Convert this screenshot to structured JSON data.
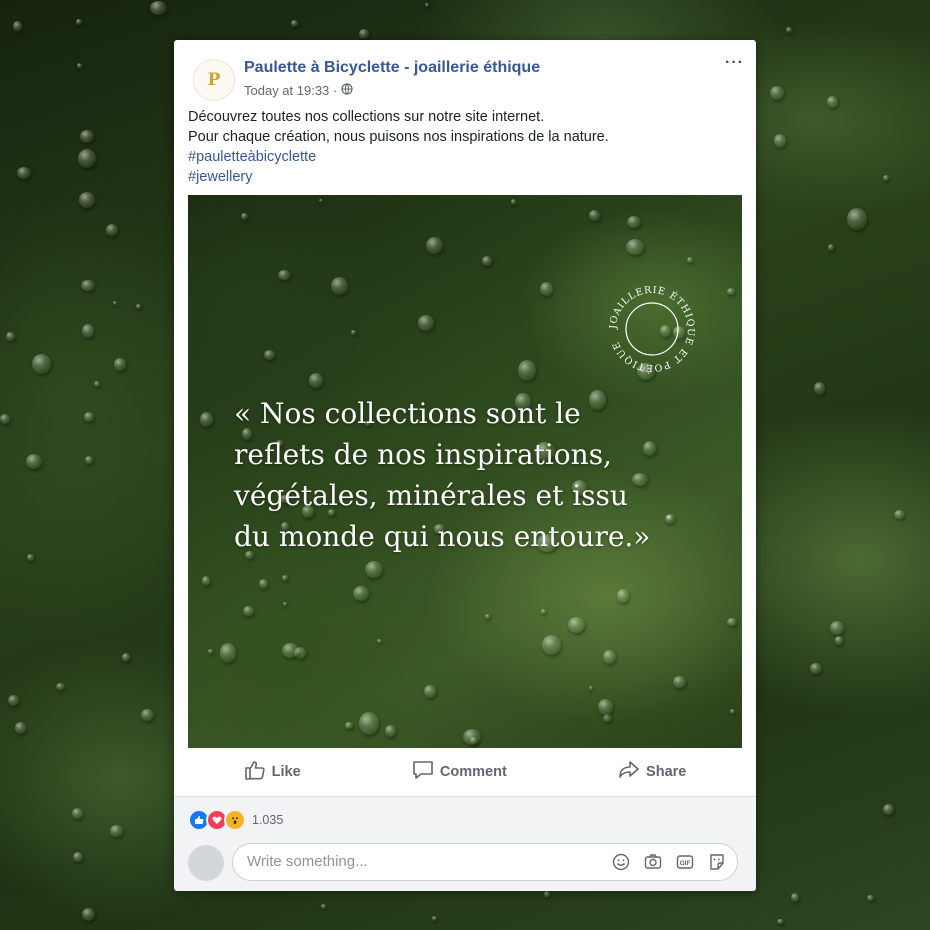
{
  "post": {
    "page_name": "Paulette à Bicyclette - joaillerie éthique",
    "avatar_letter": "P",
    "timestamp": "Today at 19:33 ·",
    "audience_icon": "globe-icon",
    "more_label": "···",
    "text_lines": [
      "Découvrez toutes nos collections sur notre site internet.",
      "Pour chaque création, nous puisons nos inspirations de la nature."
    ],
    "hashtags": [
      "#pauletteàbicyclette",
      "#jewellery"
    ]
  },
  "image": {
    "quote_lines": [
      "« Nos collections sont le",
      "reflets de nos inspirations,",
      "végétales, minérales et issu",
      "du monde qui nous entoure.»"
    ],
    "seal_text": "JOAILLERIE ÉTHIQUE ET POÉTIQUE"
  },
  "actions": {
    "like_label": "Like",
    "comment_label": "Comment",
    "share_label": "Share"
  },
  "footer": {
    "reaction_count": "1.035",
    "reactions": [
      "like-icon",
      "love-icon",
      "wow-icon"
    ],
    "comment_placeholder": "Write something...",
    "comment_icons": [
      "emoji-icon",
      "camera-icon",
      "gif-icon",
      "sticker-icon"
    ]
  },
  "colors": {
    "link": "#365899",
    "like_blue": "#1877f2",
    "love_red": "#f33e58",
    "wow_yellow": "#f7b125"
  }
}
